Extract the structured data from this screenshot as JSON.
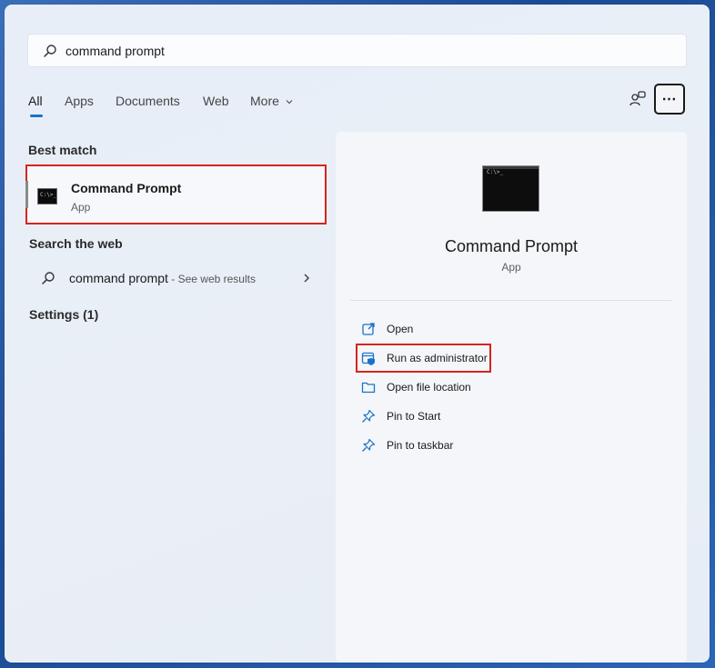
{
  "search": {
    "value": "command prompt"
  },
  "tabs": [
    {
      "label": "All"
    },
    {
      "label": "Apps"
    },
    {
      "label": "Documents"
    },
    {
      "label": "Web"
    },
    {
      "label": "More"
    }
  ],
  "sections": {
    "best_match": "Best match",
    "search_web": "Search the web",
    "settings": "Settings (1)"
  },
  "best_match": {
    "name": "Command Prompt",
    "type": "App"
  },
  "web_result": {
    "query": "command prompt",
    "suffix": " - See web results"
  },
  "detail": {
    "title": "Command Prompt",
    "type": "App",
    "actions": [
      {
        "label": "Open",
        "icon": "open-external-icon"
      },
      {
        "label": "Run as administrator",
        "icon": "shield-admin-icon"
      },
      {
        "label": "Open file location",
        "icon": "folder-icon"
      },
      {
        "label": "Pin to Start",
        "icon": "pin-icon"
      },
      {
        "label": "Pin to taskbar",
        "icon": "pin-icon"
      }
    ]
  },
  "colors": {
    "accent": "#1a73c7",
    "highlight": "#d6241d"
  }
}
